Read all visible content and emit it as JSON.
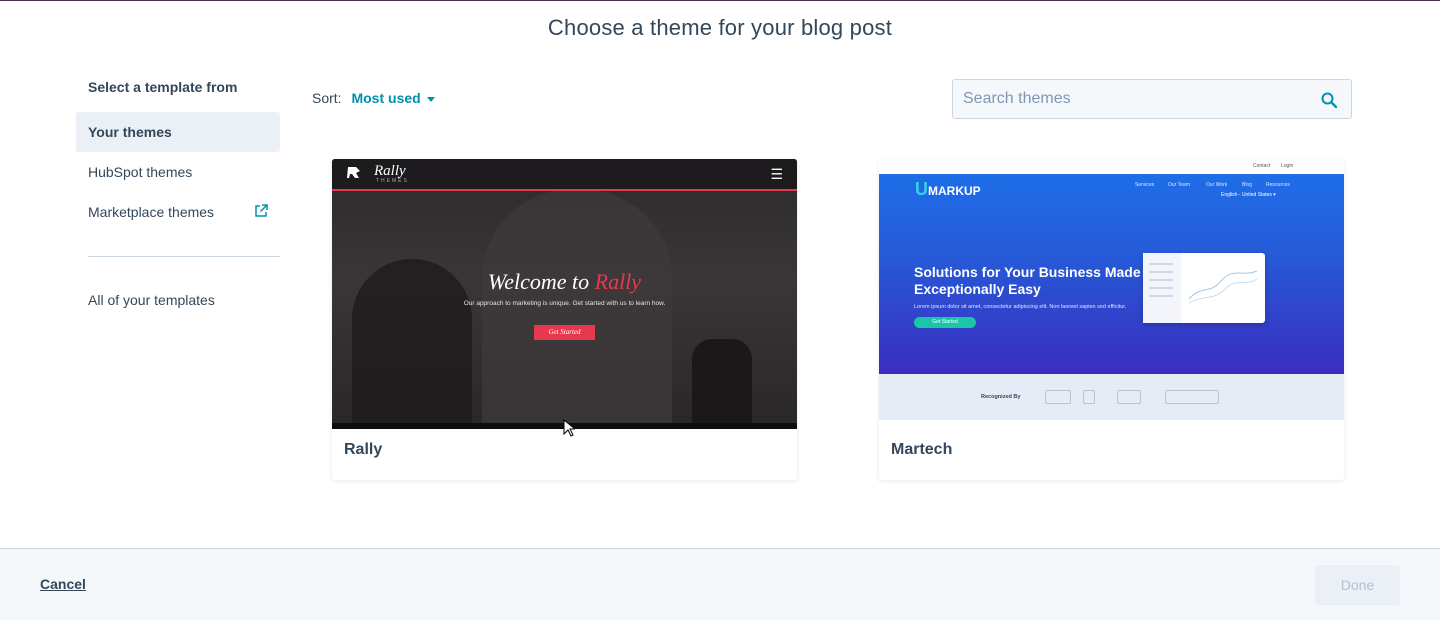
{
  "page": {
    "title": "Choose a theme for your blog post"
  },
  "sidebar": {
    "heading": "Select a template from",
    "items": [
      {
        "label": "Your themes",
        "active": true
      },
      {
        "label": "HubSpot themes",
        "active": false
      },
      {
        "label": "Marketplace themes",
        "active": false,
        "icon": "external-link-icon"
      }
    ],
    "all_templates": "All of your templates"
  },
  "sort": {
    "label": "Sort:",
    "value": "Most used"
  },
  "search": {
    "placeholder": "Search themes",
    "value": "",
    "icon": "search-icon"
  },
  "themes": [
    {
      "name": "Rally",
      "preview": {
        "logo": "Rally",
        "logo_sub": "THEMES",
        "menu_icon": "☰",
        "headline_prefix": "Welcome to",
        "headline_accent": "Rally",
        "subtext": "Our approach to marketing is unique. Get started with us to learn how.",
        "button": "Get Started"
      }
    },
    {
      "name": "Martech",
      "preview": {
        "top_links": [
          "Contact",
          "Login"
        ],
        "logo_u": "U",
        "logo_rest": "MARKUP",
        "nav": [
          "Services",
          "Our Team",
          "Our Work",
          "Blog",
          "Resources"
        ],
        "language": "English - United States ▾",
        "headline": "Solutions for Your Business Made Exceptionally Easy",
        "subtext": "Lorem ipsum dolor sit amet, consectetur adipiscing elit. Non laoreet sapien sed efficitur.",
        "button": "Get Started",
        "recognized": "Recognized By"
      }
    }
  ],
  "footer": {
    "cancel": "Cancel",
    "done": "Done"
  },
  "colors": {
    "text": "#33475b",
    "link": "#0091ae",
    "active_bg": "#eaf0f6",
    "footer_bg": "#f5f8fa",
    "done_bg": "#eaf0f6",
    "done_text": "#b0c1d4",
    "rally_accent": "#e8384f"
  }
}
